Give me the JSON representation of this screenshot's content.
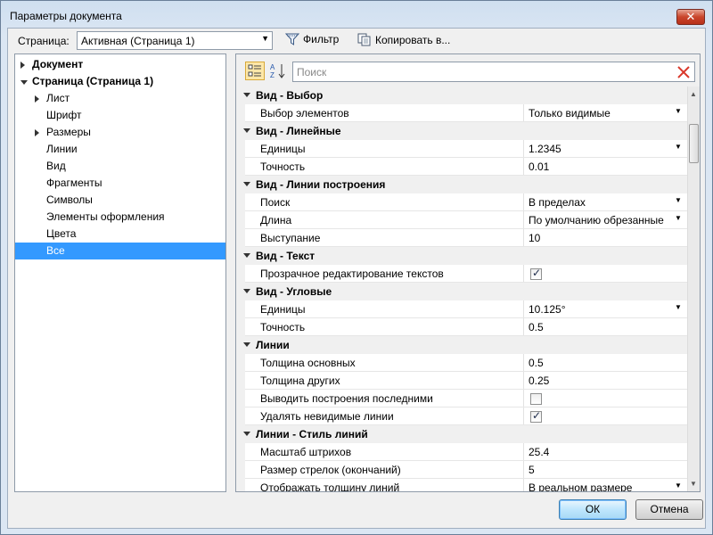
{
  "window": {
    "title": "Параметры документа",
    "close_glyph": "✕"
  },
  "toolbar": {
    "page_label": "Страница:",
    "page_value": "Активная (Страница 1)",
    "filter_label": "Фильтр",
    "copy_label": "Копировать в..."
  },
  "tree": [
    {
      "label": "Документ",
      "level": 0,
      "bold": true,
      "expander": "collapsed"
    },
    {
      "label": "Страница (Страница 1)",
      "level": 0,
      "bold": true,
      "expander": "expanded"
    },
    {
      "label": "Лист",
      "level": 1,
      "bold": false,
      "expander": "collapsed"
    },
    {
      "label": "Шрифт",
      "level": 1,
      "bold": false,
      "expander": "none"
    },
    {
      "label": "Размеры",
      "level": 1,
      "bold": false,
      "expander": "collapsed"
    },
    {
      "label": "Линии",
      "level": 1,
      "bold": false,
      "expander": "none"
    },
    {
      "label": "Вид",
      "level": 1,
      "bold": false,
      "expander": "none"
    },
    {
      "label": "Фрагменты",
      "level": 1,
      "bold": false,
      "expander": "none"
    },
    {
      "label": "Символы",
      "level": 1,
      "bold": false,
      "expander": "none"
    },
    {
      "label": "Элементы оформления",
      "level": 1,
      "bold": false,
      "expander": "none"
    },
    {
      "label": "Цвета",
      "level": 1,
      "bold": false,
      "expander": "none"
    },
    {
      "label": "Все",
      "level": 1,
      "bold": false,
      "expander": "none",
      "selected": true
    }
  ],
  "search": {
    "placeholder": "Поиск"
  },
  "grid": [
    {
      "type": "category",
      "name": "Вид - Выбор"
    },
    {
      "type": "prop",
      "name": "Выбор элементов",
      "value": "Только видимые",
      "dropdown": true
    },
    {
      "type": "category",
      "name": "Вид - Линейные"
    },
    {
      "type": "prop",
      "name": "Единицы",
      "value": "1.2345",
      "dropdown": true
    },
    {
      "type": "prop",
      "name": "Точность",
      "value": "0.01"
    },
    {
      "type": "category",
      "name": "Вид - Линии построения"
    },
    {
      "type": "prop",
      "name": "Поиск",
      "value": "В пределах",
      "dropdown": true
    },
    {
      "type": "prop",
      "name": "Длина",
      "value": "По умолчанию обрезанные",
      "dropdown": true
    },
    {
      "type": "prop",
      "name": "Выступание",
      "value": "10"
    },
    {
      "type": "category",
      "name": "Вид - Текст"
    },
    {
      "type": "prop",
      "name": "Прозрачное редактирование текстов",
      "checkbox": true,
      "checked": true
    },
    {
      "type": "category",
      "name": "Вид - Угловые"
    },
    {
      "type": "prop",
      "name": "Единицы",
      "value": "10.125°",
      "dropdown": true
    },
    {
      "type": "prop",
      "name": "Точность",
      "value": "0.5"
    },
    {
      "type": "category",
      "name": "Линии"
    },
    {
      "type": "prop",
      "name": "Толщина основных",
      "value": "0.5"
    },
    {
      "type": "prop",
      "name": "Толщина других",
      "value": "0.25"
    },
    {
      "type": "prop",
      "name": "Выводить построения последними",
      "checkbox": true,
      "checked": false
    },
    {
      "type": "prop",
      "name": "Удалять невидимые линии",
      "checkbox": true,
      "checked": true
    },
    {
      "type": "category",
      "name": "Линии - Стиль линий"
    },
    {
      "type": "prop",
      "name": "Масштаб штрихов",
      "value": "25.4"
    },
    {
      "type": "prop",
      "name": "Размер стрелок (окончаний)",
      "value": "5"
    },
    {
      "type": "prop",
      "name": "Отображать толщину линий",
      "value": "В реальном размере",
      "dropdown": true
    }
  ],
  "buttons": {
    "ok": "ОК",
    "cancel": "Отмена"
  }
}
